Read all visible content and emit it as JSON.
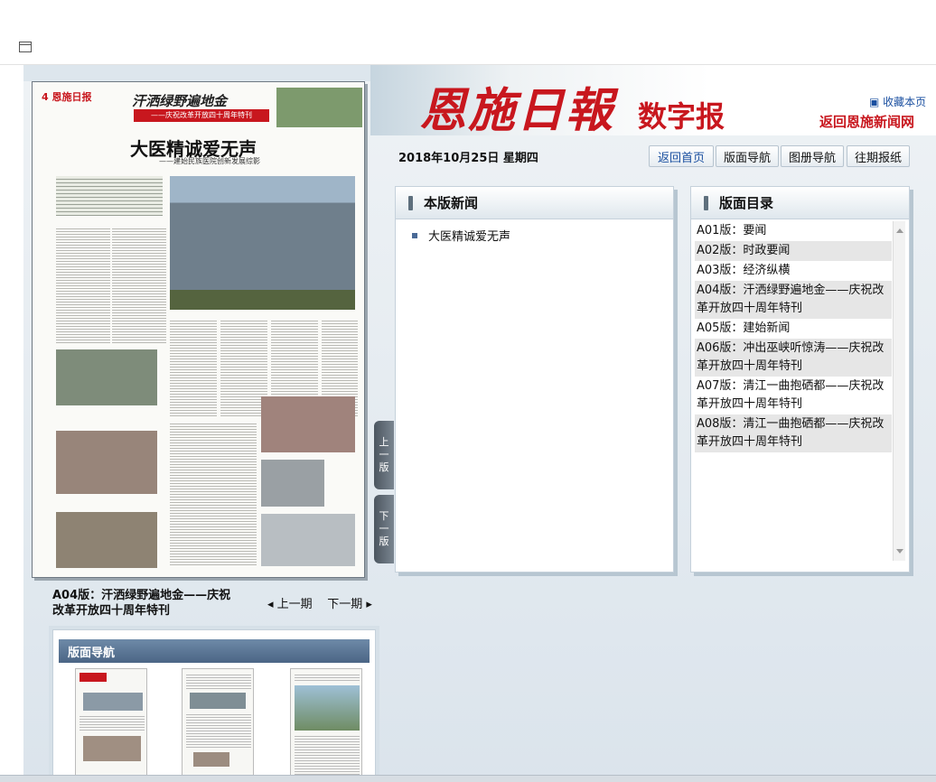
{
  "masthead": {
    "logo": "恩施日報",
    "logo_sub": "数字报",
    "favorite": "收藏本页",
    "back_news": "返回恩施新闻网"
  },
  "date": "2018年10月25日 星期四",
  "nav_buttons": [
    "返回首页",
    "版面导航",
    "图册导航",
    "往期报纸"
  ],
  "paper": {
    "page_label": "4",
    "paper_name": "恩施日报",
    "banner": "汗洒绿野遍地金",
    "banner_sub": "——庆祝改革开放四十周年特刊",
    "headline": "大医精诚爱无声",
    "subheadline": "——建始民族医院创新发展综影"
  },
  "flip": {
    "prev": [
      "上",
      "一",
      "版"
    ],
    "next": [
      "下",
      "一",
      "版"
    ]
  },
  "page_caption": "A04版：汗洒绿野遍地金——庆祝改革开放四十周年特刊",
  "prev_issue": "上一期",
  "next_issue": "下一期",
  "news_panel": {
    "title": "本版新闻",
    "items": [
      "大医精诚爱无声"
    ]
  },
  "dir_panel": {
    "title": "版面目录",
    "items": [
      "A01版：要闻",
      "A02版：时政要闻",
      "A03版：经济纵横",
      "A04版：汗洒绿野遍地金——庆祝改革开放四十周年特刊",
      "A05版：建始新闻",
      "A06版：冲出巫峡听惊涛——庆祝改革开放四十周年特刊",
      "A07版：清江一曲抱硒都——庆祝改革开放四十周年特刊",
      "A08版：清江一曲抱硒都——庆祝改革开放四十周年特刊"
    ]
  },
  "thumb_panel": {
    "title": "版面导航"
  },
  "colors": {
    "brand_red": "#c8171e",
    "link_blue": "#1a4fa0",
    "panel_border": "#c5d1db"
  }
}
